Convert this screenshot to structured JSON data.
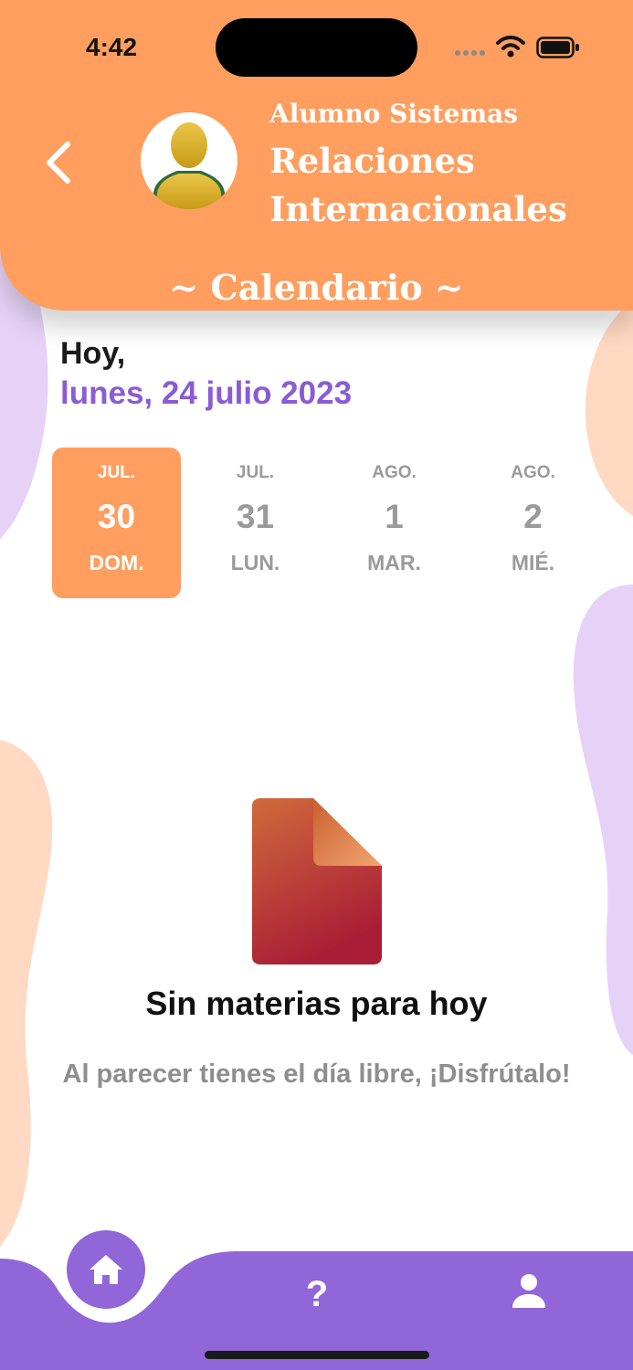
{
  "status_bar": {
    "time": "4:42"
  },
  "header": {
    "subtitle": "Alumno Sistemas",
    "name_line1": "Relaciones",
    "name_line2": "Internacionales",
    "section_title": "~ Calendario ~",
    "back_icon": "chevron-left-icon",
    "avatar_icon": "user-avatar-icon"
  },
  "today": {
    "label": "Hoy,",
    "date": "lunes, 24 julio 2023"
  },
  "days": [
    {
      "month": "JUL.",
      "day": "30",
      "weekday": "DOM.",
      "selected": true
    },
    {
      "month": "JUL.",
      "day": "31",
      "weekday": "LUN.",
      "selected": false
    },
    {
      "month": "AGO.",
      "day": "1",
      "weekday": "MAR.",
      "selected": false
    },
    {
      "month": "AGO.",
      "day": "2",
      "weekday": "MIÉ.",
      "selected": false
    }
  ],
  "empty_state": {
    "icon": "document-icon",
    "title": "Sin materias para hoy",
    "message": "Al parecer tienes el día libre, ¡Disfrútalo!"
  },
  "bottom_nav": {
    "items": [
      {
        "icon": "home-icon",
        "active": true
      },
      {
        "icon": "question-icon",
        "glyph": "?"
      },
      {
        "icon": "profile-icon"
      }
    ]
  },
  "colors": {
    "accent_orange": "#FF9E5E",
    "accent_purple": "#9066D9",
    "date_purple": "#8A5BD6",
    "blob_purple": "#E6D2F7",
    "blob_peach": "#FFD9C2"
  }
}
